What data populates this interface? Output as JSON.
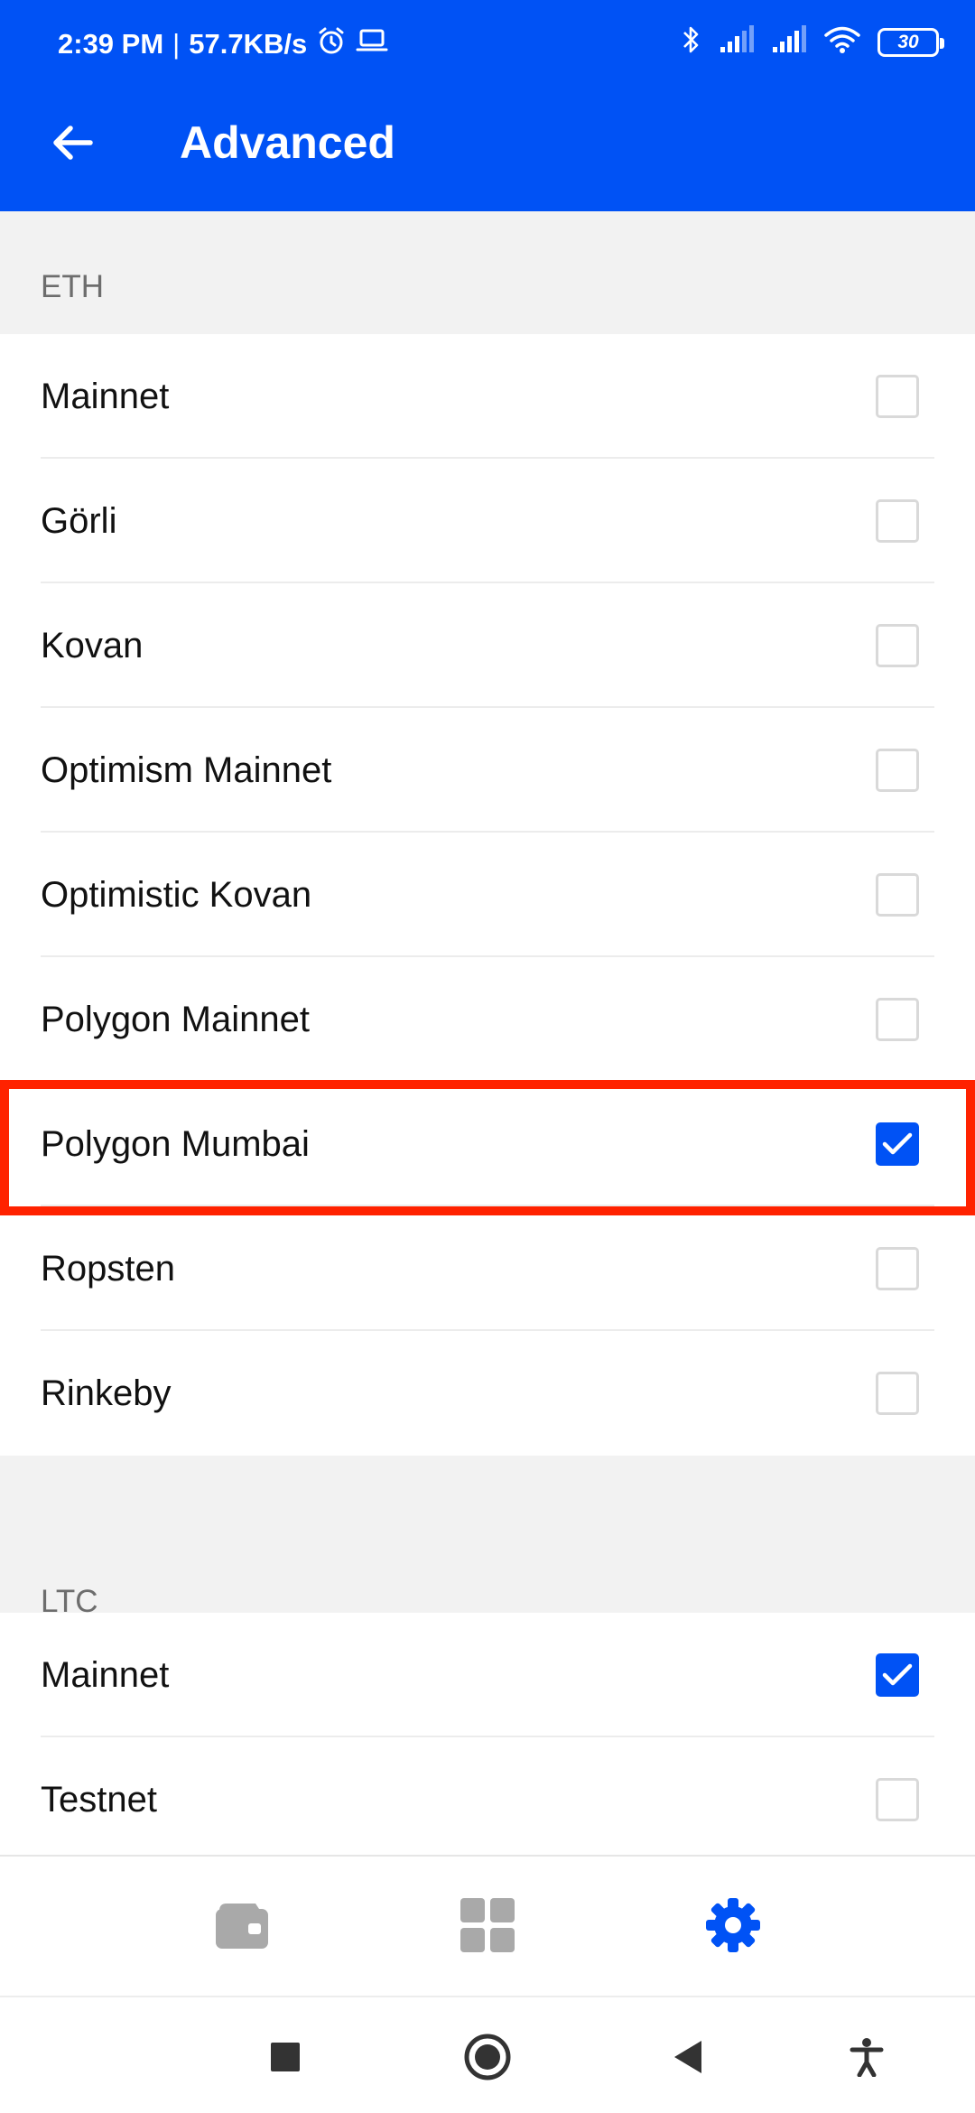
{
  "status_bar": {
    "time": "2:39 PM",
    "separator": "|",
    "speed": "57.7KB/s",
    "battery": "30",
    "icons": [
      "alarm-icon",
      "laptop-icon",
      "bluetooth-icon",
      "signal-icon",
      "signal-icon",
      "wifi-icon",
      "battery-icon"
    ]
  },
  "app_bar": {
    "title": "Advanced",
    "back_icon": "back-arrow-icon"
  },
  "sections": {
    "eth": {
      "header": "ETH",
      "items": [
        {
          "label": "Mainnet",
          "checked": false
        },
        {
          "label": "Görli",
          "checked": false
        },
        {
          "label": "Kovan",
          "checked": false
        },
        {
          "label": "Optimism Mainnet",
          "checked": false
        },
        {
          "label": "Optimistic Kovan",
          "checked": false
        },
        {
          "label": "Polygon Mainnet",
          "checked": false
        },
        {
          "label": "Polygon Mumbai",
          "checked": true
        },
        {
          "label": "Ropsten",
          "checked": false
        },
        {
          "label": "Rinkeby",
          "checked": false
        }
      ]
    },
    "ltc": {
      "header": "LTC",
      "items": [
        {
          "label": "Mainnet",
          "checked": true
        },
        {
          "label": "Testnet",
          "checked": false
        }
      ]
    }
  },
  "bottom_nav": {
    "items": [
      "wallet-icon",
      "apps-grid-icon",
      "settings-gear-icon"
    ],
    "active": "settings-gear-icon"
  },
  "colors": {
    "brand": "#0052f5",
    "highlight": "#ff2200",
    "inactive_icon": "#a9a9a9"
  }
}
